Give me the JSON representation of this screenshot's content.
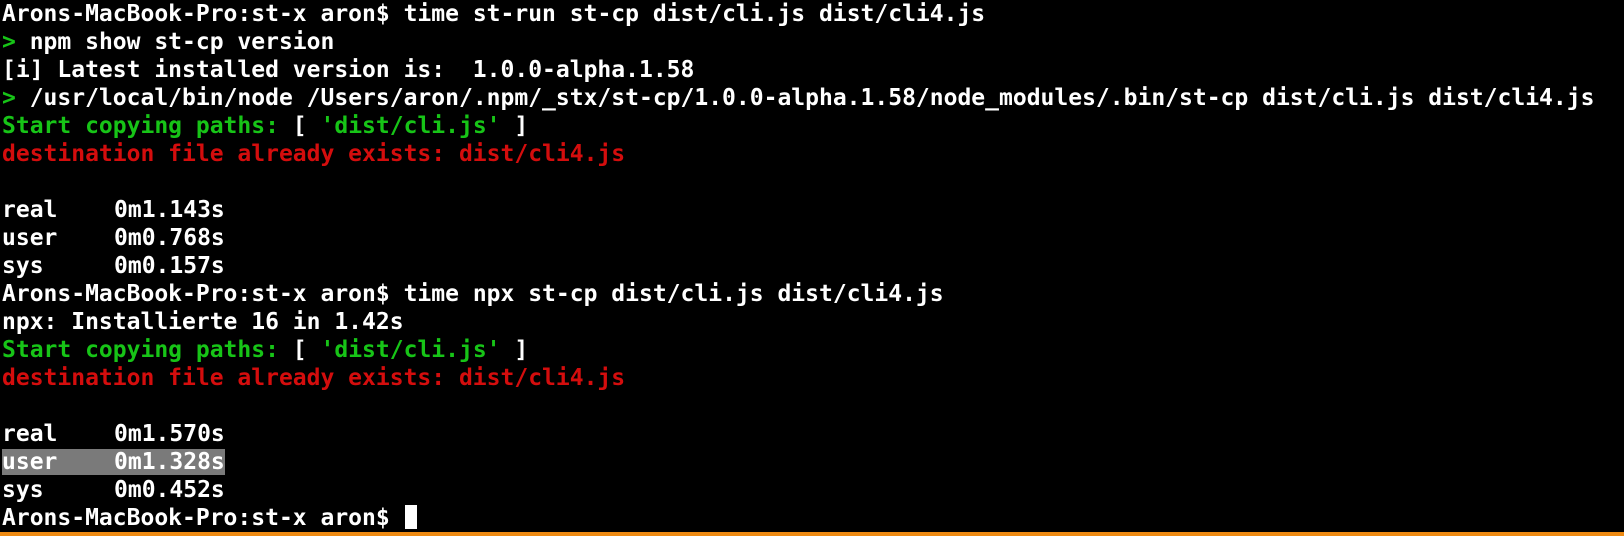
{
  "terminal": {
    "colors": {
      "background": "#000000",
      "text": "#ffffff",
      "prompt_arrow": "#17c417",
      "success": "#17c417",
      "error": "#d40d0d",
      "selection": "#7a7a7a",
      "border_accent": "#ee8a12"
    },
    "prompt": "Arons-MacBook-Pro:st-x aron$ ",
    "run1": {
      "command": "time st-run st-cp dist/cli.js dist/cli4.js",
      "npm_arrow": "> ",
      "npm_cmd": "npm show st-cp version",
      "installed_msg": "[i] Latest installed version is:  1.0.0-alpha.1.58",
      "node_arrow": "> ",
      "node_cmd": "/usr/local/bin/node /Users/aron/.npm/_stx/st-cp/1.0.0-alpha.1.58/node_modules/.bin/st-cp dist/cli.js dist/cli4.js",
      "copy_label": "Start copying paths: ",
      "copy_open": "[ ",
      "copy_path": "'dist/cli.js'",
      "copy_close": " ]",
      "error": "destination file already exists: dist/cli4.js",
      "timing": {
        "real_label": "real",
        "real_value": "0m1.143s",
        "user_label": "user",
        "user_value": "0m0.768s",
        "sys_label": "sys",
        "sys_value": "0m0.157s"
      }
    },
    "run2": {
      "command": "time npx st-cp dist/cli.js dist/cli4.js",
      "npx_msg": "npx: Installierte 16 in 1.42s",
      "copy_label": "Start copying paths: ",
      "copy_open": "[ ",
      "copy_path": "'dist/cli.js'",
      "copy_close": " ]",
      "error": "destination file already exists: dist/cli4.js",
      "timing": {
        "real_label": "real",
        "real_value": "0m1.570s",
        "user_label": "user",
        "user_value": "0m1.328s",
        "sys_label": "sys",
        "sys_value": "0m0.452s"
      }
    },
    "final_prompt": "Arons-MacBook-Pro:st-x aron$ "
  }
}
